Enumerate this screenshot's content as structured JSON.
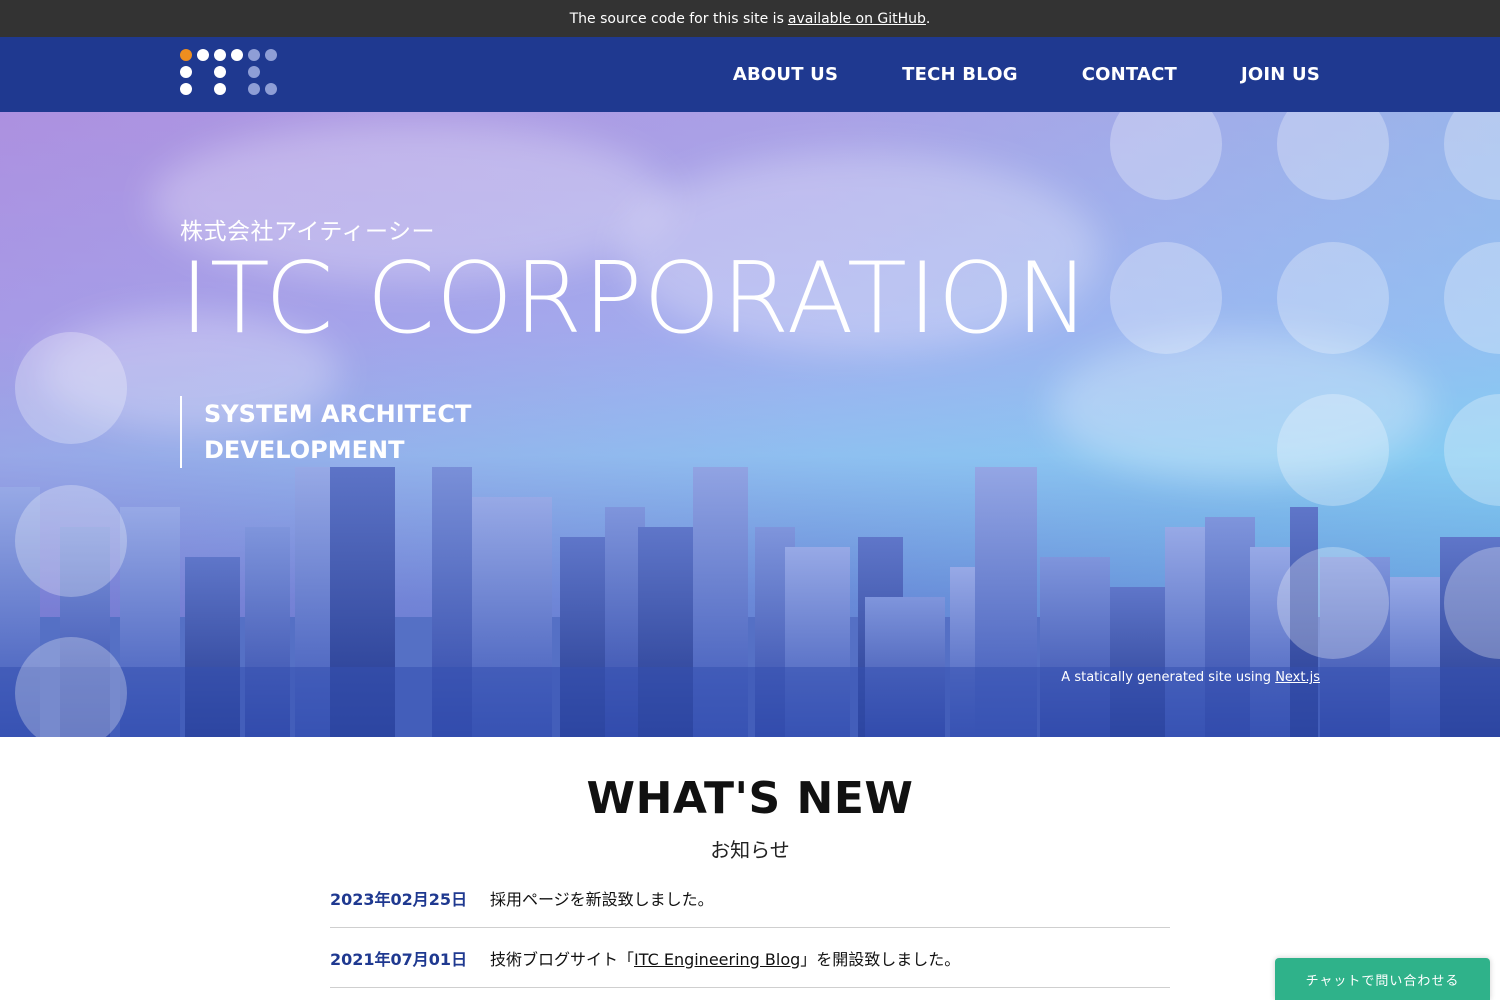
{
  "banner": {
    "text": "The source code for this site is",
    "link_text": "available on GitHub",
    "suffix": "."
  },
  "header": {
    "nav": [
      {
        "label": "ABOUT US"
      },
      {
        "label": "TECH BLOG"
      },
      {
        "label": "CONTACT"
      },
      {
        "label": "JOIN US"
      }
    ]
  },
  "hero": {
    "subtitle": "株式会社アイティーシー",
    "title": "ITC CORPORATION",
    "tagline_line1": "SYSTEM ARCHITECT",
    "tagline_line2": "DEVELOPMENT",
    "credit_text": "A statically generated site using",
    "credit_link": "Next.js"
  },
  "news": {
    "title": "WHAT'S NEW",
    "subtitle": "お知らせ",
    "items": [
      {
        "date": "2023年02月25日",
        "text": "採用ページを新設致しました。"
      },
      {
        "date": "2021年07月01日",
        "prefix": "技術ブログサイト「",
        "link": "ITC Engineering Blog",
        "suffix": "」を開設致しました。"
      }
    ]
  },
  "chat": {
    "label": "チャットで問い合わせる"
  },
  "colors": {
    "header_bg": "#1f3990",
    "banner_bg": "#333333",
    "accent_orange": "#ee8e1f",
    "date_color": "#1f3990",
    "chat_bg": "#2fb28a"
  }
}
